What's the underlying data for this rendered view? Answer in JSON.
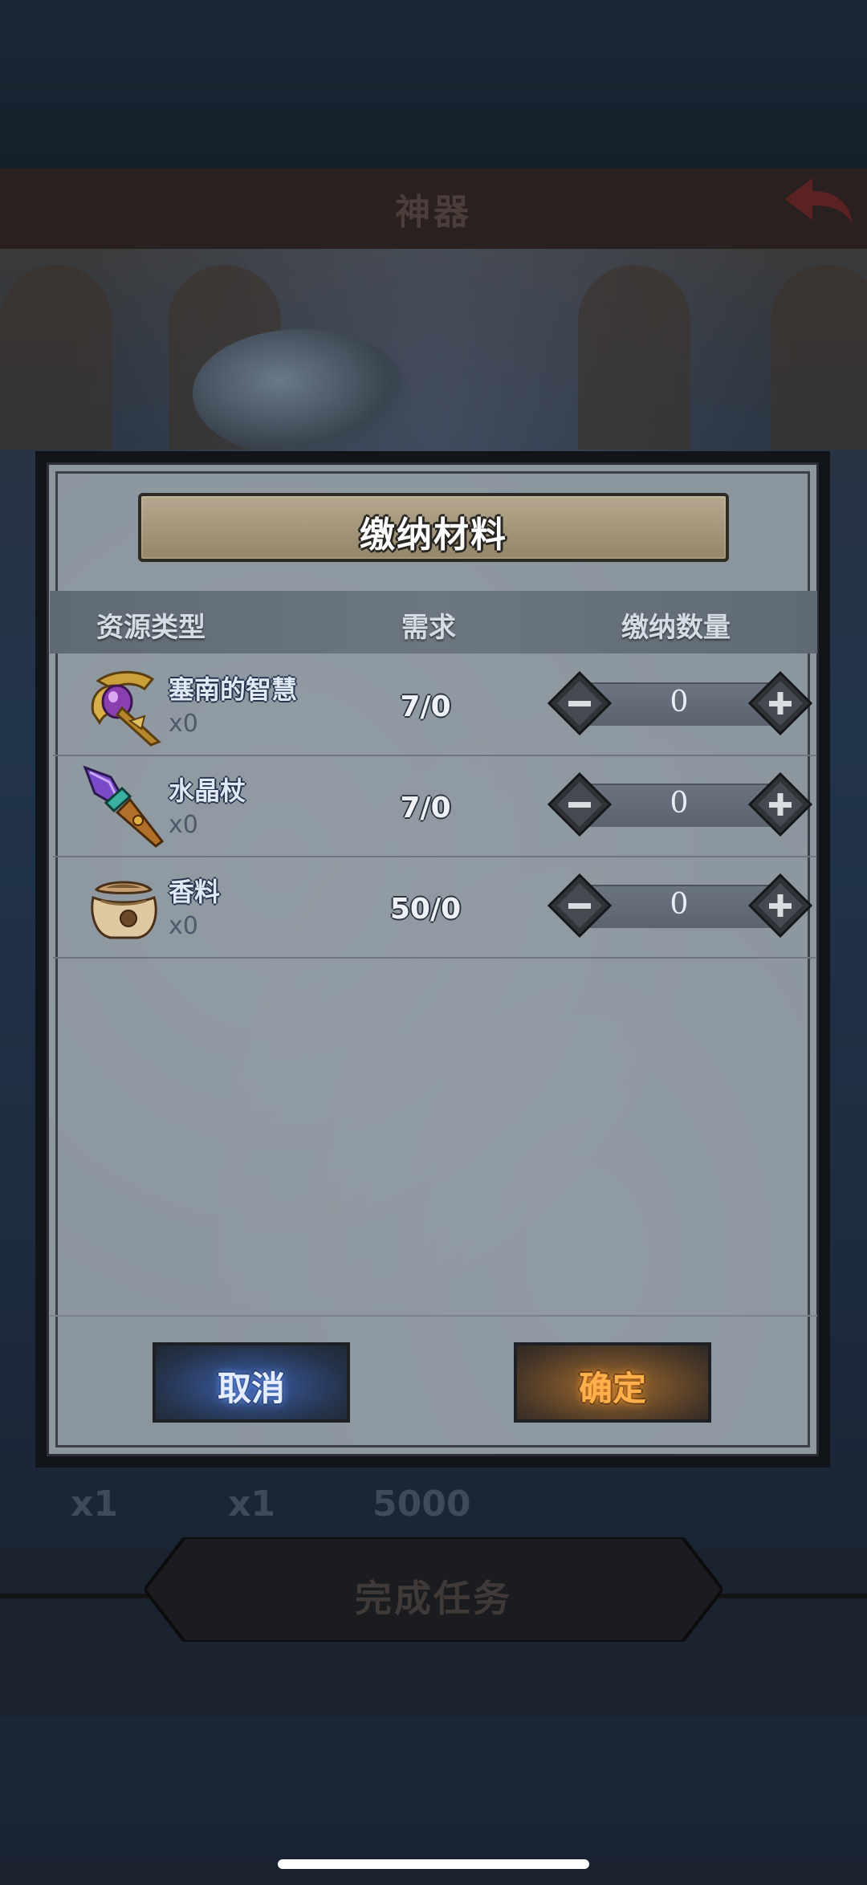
{
  "background": {
    "screen_title": "神器",
    "reward_counts": [
      "x1",
      "x1",
      "5000"
    ],
    "complete_button_label": "完成任务"
  },
  "dialog": {
    "title": "缴纳材料",
    "columns": {
      "resource_type": "资源类型",
      "requirement": "需求",
      "submit_quantity": "缴纳数量"
    },
    "items": [
      {
        "name": "塞南的智慧",
        "owned": "x0",
        "requirement": "7/0",
        "quantity": "0",
        "icon": "golden-orb-relic-icon"
      },
      {
        "name": "水晶杖",
        "owned": "x0",
        "requirement": "7/0",
        "quantity": "0",
        "icon": "crystal-staff-icon"
      },
      {
        "name": "香料",
        "owned": "x0",
        "requirement": "50/0",
        "quantity": "0",
        "icon": "spice-sack-icon"
      }
    ],
    "cancel_label": "取消",
    "confirm_label": "确定"
  }
}
